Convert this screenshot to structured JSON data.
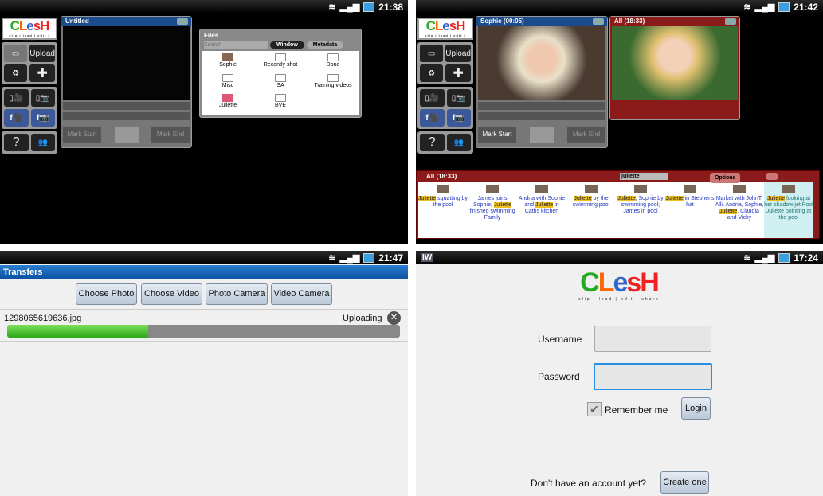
{
  "status_bars": [
    {
      "time": "21:38"
    },
    {
      "time": "21:42"
    },
    {
      "time": "21:47"
    },
    {
      "time": "17:24"
    }
  ],
  "logo": {
    "text": "CLesH",
    "tagline": "clip | load | edit | share"
  },
  "sidebar": {
    "upload_label": "Upload",
    "help_label": "?"
  },
  "editor1": {
    "title": "Untitled",
    "mark_start": "Mark Start",
    "mark_end": "Mark End"
  },
  "files": {
    "title": "Files",
    "search_placeholder": "Search",
    "tab_window": "Window",
    "tab_metadata": "Metadata",
    "items": [
      "Sophie",
      "Recently shot",
      "Done",
      "Misc",
      "SA",
      "Training videos",
      "Juliette",
      "BVE"
    ]
  },
  "editor2": {
    "title": "Sophie (00:05)",
    "mark_start": "Mark Start",
    "mark_end": "Mark End"
  },
  "all_window": {
    "title": "All (18:33)"
  },
  "timeline": {
    "title": "All (18:33)",
    "search_value": "juliette",
    "options_label": "Options",
    "highlight": "Juliette",
    "clips": [
      {
        "pre": "",
        "hl": "Juliette",
        "post": " squatting by the pool"
      },
      {
        "pre": "James joins Sophie; ",
        "hl": "Juliette",
        "post": " finished swimming Family"
      },
      {
        "pre": "Andria with Sophie and ",
        "hl": "Juliette",
        "post": " in Caths kitchen"
      },
      {
        "pre": "",
        "hl": "Juliette",
        "post": " by the swimming pool"
      },
      {
        "pre": "",
        "hl": "Juliette",
        "post": ", Sophie by swimming pool; James in pool"
      },
      {
        "pre": "",
        "hl": "Juliette",
        "post": " in Stephens hat"
      },
      {
        "pre": "Market with JohnT, Alli, Andria, Sophie, ",
        "hl": "Juliette",
        "post": ", Claudia and Vicky"
      },
      {
        "pre": "",
        "hl": "Juliette",
        "post": " looking at her shadow jet Pool Juliette pointing at the pool"
      }
    ]
  },
  "transfers": {
    "title": "Transfers",
    "buttons": [
      "Choose Photo",
      "Choose Video",
      "Photo Camera",
      "Video Camera"
    ],
    "file": "1298065619636.jpg",
    "status": "Uploading",
    "progress": 0.36
  },
  "login": {
    "app_icon": "IW",
    "username_label": "Username",
    "password_label": "Password",
    "username_value": "",
    "password_value": "",
    "remember_label": "Remember me",
    "remember_checked": true,
    "login_button": "Login",
    "no_account": "Don't have an account yet?",
    "create_button": "Create one"
  }
}
